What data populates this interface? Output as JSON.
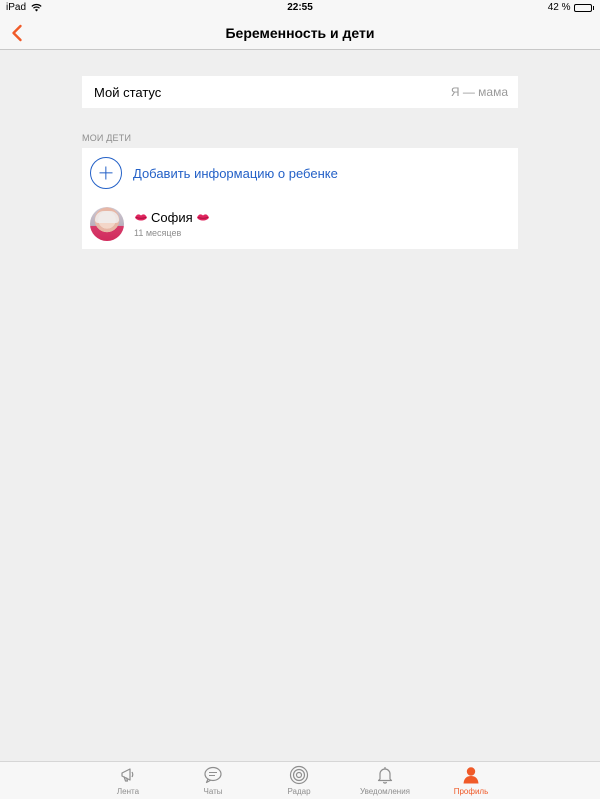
{
  "status_bar": {
    "device": "iPad",
    "time": "22:55",
    "battery": "42 %",
    "battery_level": 0.42
  },
  "nav": {
    "title": "Беременность и дети",
    "back_icon": "chevron-left-icon"
  },
  "status_card": {
    "label": "Мой статус",
    "value": "Я — мама"
  },
  "children_section": {
    "header": "МОИ ДЕТИ",
    "add_label": "Добавить информацию о ребенке",
    "children": [
      {
        "name": "София",
        "age": "11 месяцев"
      }
    ]
  },
  "tabbar": {
    "tabs": [
      {
        "label": "Лента",
        "icon": "megaphone-icon"
      },
      {
        "label": "Чаты",
        "icon": "chat-bubble-icon"
      },
      {
        "label": "Радар",
        "icon": "radar-icon"
      },
      {
        "label": "Уведомления",
        "icon": "bell-icon"
      },
      {
        "label": "Профиль",
        "icon": "person-icon"
      }
    ],
    "active": "Профиль"
  },
  "colors": {
    "accent": "#f05a28",
    "link": "#2461c7",
    "inactive": "#8e8e8e",
    "background": "#efefef"
  }
}
